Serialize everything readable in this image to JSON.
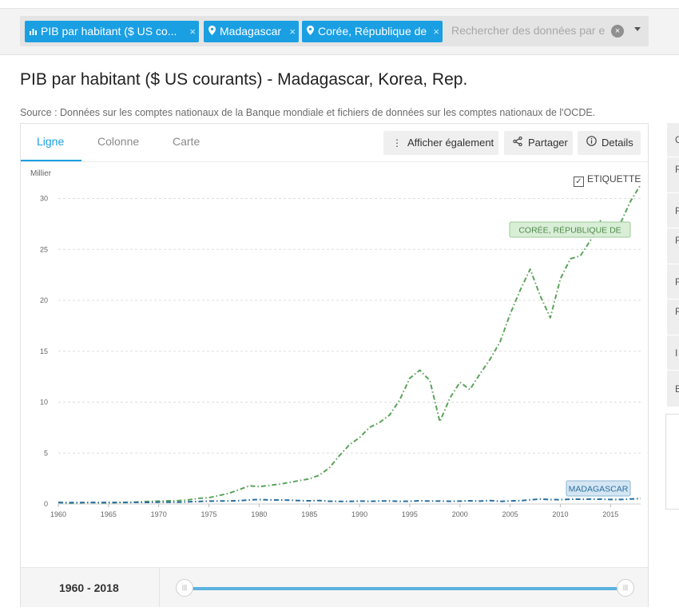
{
  "filters": {
    "chips": [
      {
        "icon": "bar-chart-icon",
        "label": "PIB par habitant ($ US co..."
      },
      {
        "icon": "location-pin-icon",
        "label": "Madagascar"
      },
      {
        "icon": "location-pin-icon",
        "label": "Corée, République de"
      }
    ],
    "remove_glyph": "×",
    "search_placeholder": "Rechercher des données par e"
  },
  "title": "PIB par habitant ($ US courants) - Madagascar, Korea, Rep.",
  "source": "Source : Données sur les comptes nationaux de la Banque mondiale et fichiers de données sur les comptes nationaux de l'OCDE.",
  "tabs": [
    "Ligne",
    "Colonne",
    "Carte"
  ],
  "buttons": {
    "also_show": "Afficher également",
    "share": "Partager",
    "details": "Details"
  },
  "label_toggle": {
    "label": "ETIQUETTE",
    "checked": true
  },
  "footer": {
    "range_start": "1960",
    "range_sep": " - ",
    "range_end": "2018"
  },
  "right_panel_initials": [
    "C",
    "F",
    "F",
    "F",
    "F",
    "F",
    "I",
    "E"
  ],
  "colors": {
    "accent": "#1a9fe3",
    "korea": "#5aa35a",
    "madagascar": "#2a6fa0"
  },
  "chart_data": {
    "type": "line",
    "title": "",
    "ylabel": "Millier",
    "xlabel": "",
    "xlim": [
      1960,
      2018
    ],
    "ylim": [
      0,
      32
    ],
    "x_ticks": [
      1960,
      1965,
      1970,
      1975,
      1980,
      1985,
      1990,
      1995,
      2000,
      2005,
      2010,
      2015
    ],
    "y_ticks": [
      0,
      5,
      10,
      15,
      20,
      25,
      30
    ],
    "grid": true,
    "line_style": "dash-dot",
    "series": [
      {
        "name": "CORÉE, RÉPUBLIQUE DE",
        "color": "#5aa35a",
        "x": [
          1960,
          1961,
          1962,
          1963,
          1964,
          1965,
          1966,
          1967,
          1968,
          1969,
          1970,
          1971,
          1972,
          1973,
          1974,
          1975,
          1976,
          1977,
          1978,
          1979,
          1980,
          1981,
          1982,
          1983,
          1984,
          1985,
          1986,
          1987,
          1988,
          1989,
          1990,
          1991,
          1992,
          1993,
          1994,
          1995,
          1996,
          1997,
          1998,
          1999,
          2000,
          2001,
          2002,
          2003,
          2004,
          2005,
          2006,
          2007,
          2008,
          2009,
          2010,
          2011,
          2012,
          2013,
          2014,
          2015,
          2016,
          2017,
          2018
        ],
        "values": [
          0.16,
          0.09,
          0.11,
          0.15,
          0.12,
          0.11,
          0.14,
          0.16,
          0.2,
          0.25,
          0.28,
          0.31,
          0.33,
          0.41,
          0.56,
          0.62,
          0.83,
          1.05,
          1.4,
          1.78,
          1.7,
          1.83,
          1.94,
          2.11,
          2.3,
          2.46,
          2.83,
          3.55,
          4.75,
          5.82,
          6.52,
          7.52,
          8.0,
          8.74,
          10.21,
          12.34,
          13.14,
          12.13,
          8.08,
          10.41,
          11.95,
          11.25,
          12.78,
          14.21,
          15.92,
          18.64,
          21.0,
          23.06,
          20.43,
          18.29,
          22.09,
          24.08,
          24.37,
          25.89,
          27.81,
          27.1,
          27.61,
          29.74,
          31.36
        ]
      },
      {
        "name": "MADAGASCAR",
        "color": "#2a6fa0",
        "x": [
          1960,
          1961,
          1962,
          1963,
          1964,
          1965,
          1966,
          1967,
          1968,
          1969,
          1970,
          1971,
          1972,
          1973,
          1974,
          1975,
          1976,
          1977,
          1978,
          1979,
          1980,
          1981,
          1982,
          1983,
          1984,
          1985,
          1986,
          1987,
          1988,
          1989,
          1990,
          1991,
          1992,
          1993,
          1994,
          1995,
          1996,
          1997,
          1998,
          1999,
          2000,
          2001,
          2002,
          2003,
          2004,
          2005,
          2006,
          2007,
          2008,
          2009,
          2010,
          2011,
          2012,
          2013,
          2014,
          2015,
          2016,
          2017,
          2018
        ],
        "values": [
          0.13,
          0.13,
          0.14,
          0.14,
          0.15,
          0.15,
          0.15,
          0.15,
          0.16,
          0.16,
          0.17,
          0.17,
          0.18,
          0.21,
          0.24,
          0.28,
          0.29,
          0.3,
          0.32,
          0.39,
          0.44,
          0.4,
          0.39,
          0.38,
          0.33,
          0.31,
          0.34,
          0.27,
          0.26,
          0.25,
          0.28,
          0.26,
          0.29,
          0.3,
          0.26,
          0.27,
          0.31,
          0.28,
          0.28,
          0.27,
          0.28,
          0.31,
          0.28,
          0.34,
          0.26,
          0.3,
          0.32,
          0.41,
          0.49,
          0.43,
          0.42,
          0.47,
          0.47,
          0.48,
          0.47,
          0.44,
          0.44,
          0.49,
          0.53
        ]
      }
    ]
  }
}
